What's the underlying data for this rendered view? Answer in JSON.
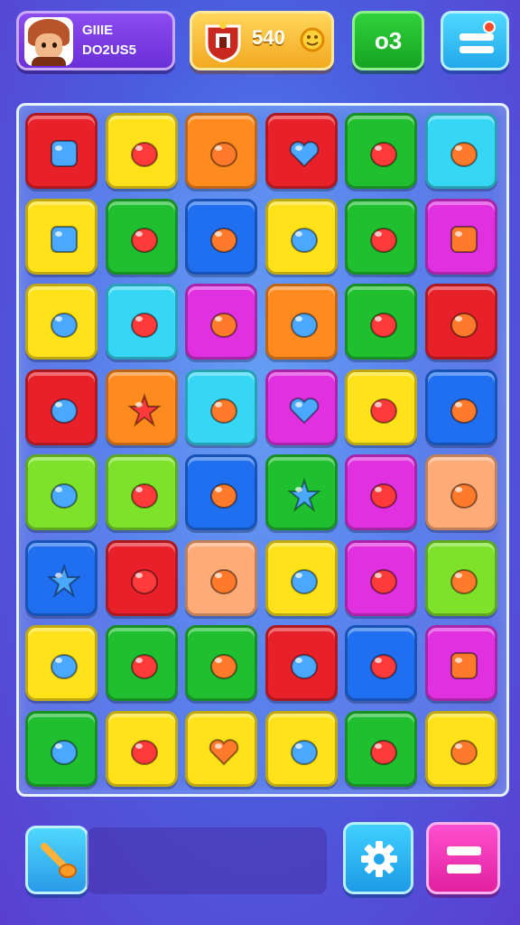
{
  "header": {
    "profile_line1": "GIIIE",
    "profile_line2": "DO2US5",
    "score": "540",
    "moves": "o3"
  },
  "colors": {
    "red": "#e8202a",
    "yellow": "#ffe21a",
    "orange": "#ff8a1e",
    "green": "#1fbf2f",
    "cyan": "#36d7f5",
    "lime": "#7ee22a",
    "blue": "#1f6ff0",
    "magenta": "#e030e0",
    "peach": "#ffab78",
    "pink": "#ff4fc8"
  },
  "board": {
    "rows": [
      [
        {
          "color": "red",
          "icon": "app-grid-icon"
        },
        {
          "color": "yellow",
          "icon": "water-drop-icon"
        },
        {
          "color": "orange",
          "icon": "fire-drop-icon"
        },
        {
          "color": "red",
          "icon": "green-heart-icon"
        },
        {
          "color": "green",
          "icon": "green-apple-icon"
        },
        {
          "color": "cyan",
          "icon": "bowl-icon"
        }
      ],
      [
        {
          "color": "yellow",
          "icon": "bag-icon"
        },
        {
          "color": "green",
          "icon": "pink-fruit-icon"
        },
        {
          "color": "blue",
          "icon": "green-fruit-icon"
        },
        {
          "color": "yellow",
          "icon": "cyan-blob-face-icon"
        },
        {
          "color": "green",
          "icon": "red-apple-icon"
        },
        {
          "color": "magenta",
          "icon": "calendar-box-icon"
        }
      ],
      [
        {
          "color": "yellow",
          "icon": "purple-orb-icon"
        },
        {
          "color": "cyan",
          "icon": "cloud-face-icon"
        },
        {
          "color": "magenta",
          "icon": "potion-icon"
        },
        {
          "color": "orange",
          "icon": "swirl-c-icon"
        },
        {
          "color": "green",
          "icon": "rock-creature-icon"
        },
        {
          "color": "red",
          "icon": "fish-icon"
        }
      ],
      [
        {
          "color": "red",
          "icon": "spiral-candy-icon"
        },
        {
          "color": "orange",
          "icon": "flag-star-icon"
        },
        {
          "color": "cyan",
          "icon": "green-hook-icon"
        },
        {
          "color": "magenta",
          "icon": "magenta-heart-icon"
        },
        {
          "color": "yellow",
          "icon": "green-swirl-icon"
        },
        {
          "color": "blue",
          "icon": "slime-face-icon"
        }
      ],
      [
        {
          "color": "lime",
          "icon": "orange-face-icon"
        },
        {
          "color": "lime",
          "icon": "leaf-gem-icon"
        },
        {
          "color": "blue",
          "icon": "tomato-icon"
        },
        {
          "color": "green",
          "icon": "purple-star-icon"
        },
        {
          "color": "magenta",
          "icon": "green-leaf-icon"
        },
        {
          "color": "peach",
          "icon": "feather-icon"
        }
      ],
      [
        {
          "color": "blue",
          "icon": "yellow-star-icon"
        },
        {
          "color": "red",
          "icon": "white-drop-icon"
        },
        {
          "color": "peach",
          "icon": "speech-bubble-icon"
        },
        {
          "color": "yellow",
          "icon": "seed-face-icon"
        },
        {
          "color": "magenta",
          "icon": "yellow-bird-icon"
        },
        {
          "color": "lime",
          "icon": "eggplant-icon"
        }
      ],
      [
        {
          "color": "yellow",
          "icon": "sun-face-icon"
        },
        {
          "color": "green",
          "icon": "purple-gear-icon"
        },
        {
          "color": "green",
          "icon": "blue-orb-icon"
        },
        {
          "color": "red",
          "icon": "banana-icon"
        },
        {
          "color": "blue",
          "icon": "pumpkin-icon"
        },
        {
          "color": "magenta",
          "icon": "mini-grid-icon"
        }
      ],
      [
        {
          "color": "green",
          "icon": "purple-swirl-icon"
        },
        {
          "color": "yellow",
          "icon": "carrot-fish-icon"
        },
        {
          "color": "yellow",
          "icon": "purple-heart-icon"
        },
        {
          "color": "yellow",
          "icon": "blue-puzzle-icon"
        },
        {
          "color": "green",
          "icon": "purple-flower-icon"
        },
        {
          "color": "yellow",
          "icon": "plum-icon"
        }
      ]
    ]
  },
  "bottombar": {
    "booster_icon": "carrot-wand-icon",
    "settings_icon": "gear-icon",
    "pause_icon": "pause-icon"
  }
}
